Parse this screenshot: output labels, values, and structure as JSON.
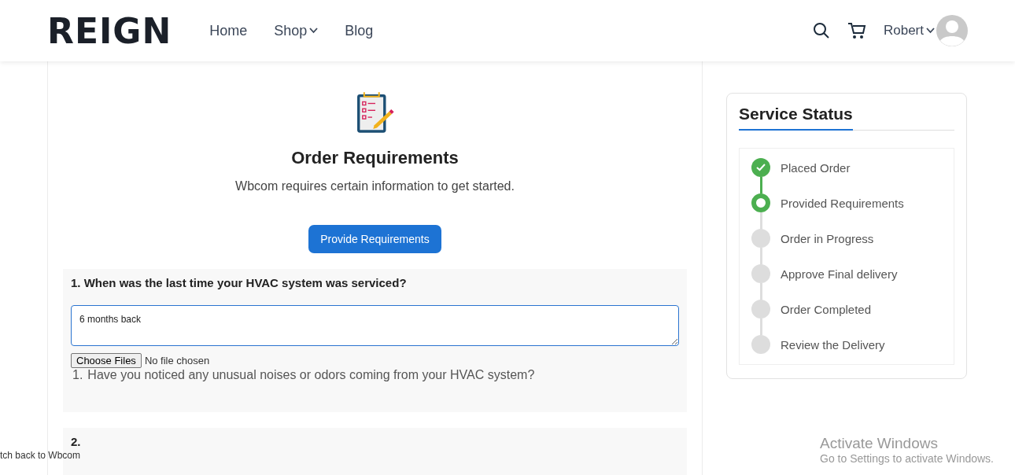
{
  "header": {
    "logo": "REIGN",
    "nav": [
      {
        "label": "Home",
        "has_menu": false
      },
      {
        "label": "Shop",
        "has_menu": true
      },
      {
        "label": "Blog",
        "has_menu": false
      }
    ],
    "user": {
      "name": "Robert"
    }
  },
  "requirements": {
    "title": "Order Requirements",
    "subtitle": "Wbcom requires certain information to get started.",
    "button": "Provide Requirements",
    "questions": [
      {
        "number": "1.",
        "question": "When was the last time your HVAC system was serviced?",
        "answer": "6 months back",
        "file_button": "Choose Files",
        "file_status": "No file chosen",
        "follow_up_number": "1.",
        "follow_up": "Have you noticed any unusual noises or odors coming from your HVAC system?"
      },
      {
        "number": "2."
      }
    ]
  },
  "service_status": {
    "title": "Service Status",
    "steps": [
      {
        "label": "Placed Order",
        "completed": true,
        "current": false
      },
      {
        "label": "Provided Requirements",
        "completed": false,
        "current": true
      },
      {
        "label": "Order in Progress",
        "completed": false,
        "current": false
      },
      {
        "label": "Approve Final delivery",
        "completed": false,
        "current": false
      },
      {
        "label": "Order Completed",
        "completed": false,
        "current": false
      },
      {
        "label": "Review the Delivery",
        "completed": false,
        "current": false
      }
    ]
  },
  "admin_bar": {
    "link": "tch back to Wbcom"
  },
  "os_notice": {
    "title": "Activate Windows",
    "message": "Go to Settings to activate Windows."
  }
}
